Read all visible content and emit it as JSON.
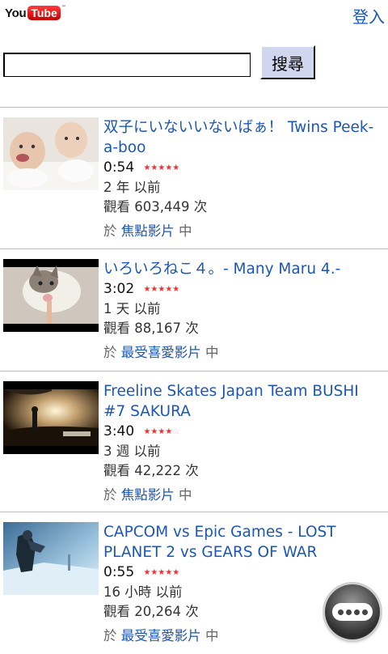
{
  "header": {
    "logo_you": "You",
    "logo_tube": "Tube",
    "logo_tm": "™",
    "login_label": "登入"
  },
  "search": {
    "value": "",
    "button_label": "搜尋"
  },
  "videos": [
    {
      "title": "双子にいないいないばぁ！ Twins Peek-a-boo",
      "duration": "0:54",
      "rating_stars": 5,
      "age": "2 年 以前",
      "views": "觀看 603,449 次",
      "from_prefix": "於",
      "category": "焦點影片",
      "from_suffix": "中"
    },
    {
      "title": "いろいろねこ４。- Many Maru 4.-",
      "duration": "3:02",
      "rating_stars": 5,
      "age": "1 天 以前",
      "views": "觀看 88,167 次",
      "from_prefix": "於",
      "category": "最受喜愛影片",
      "from_suffix": "中"
    },
    {
      "title": "Freeline Skates Japan Team BUSHI #7 SAKURA",
      "duration": "3:40",
      "rating_stars": 4,
      "age": "3 週 以前",
      "views": "觀看 42,222 次",
      "from_prefix": "於",
      "category": "焦點影片",
      "from_suffix": "中"
    },
    {
      "title": "CAPCOM vs Epic Games - LOST PLANET 2 vs GEARS OF WAR",
      "duration": "0:55",
      "rating_stars": 5,
      "age": "16 小時 以前",
      "views": "觀看 20,264 次",
      "from_prefix": "於",
      "category": "最受喜愛影片",
      "from_suffix": "中"
    }
  ],
  "colors": {
    "link": "#1a57b6",
    "star": "#ee3333",
    "button_bg": "#cfd6ee"
  }
}
